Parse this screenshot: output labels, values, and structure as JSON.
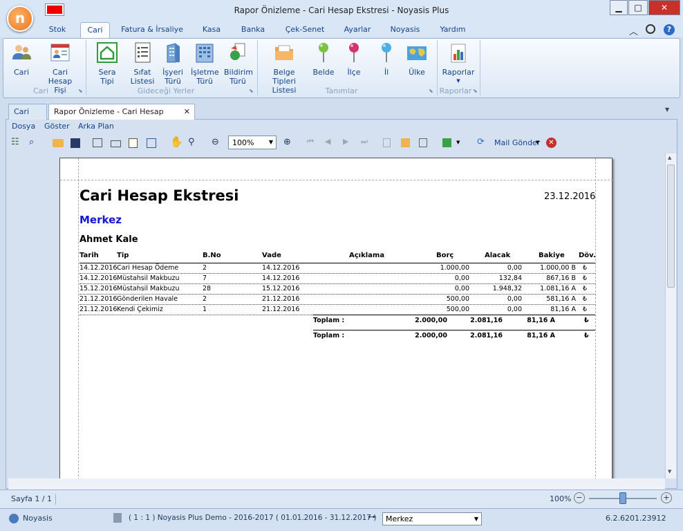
{
  "window": {
    "title": "Rapor Önizleme - Cari Hesap Ekstresi - Noyasis Plus"
  },
  "ribbon_tabs": [
    "Stok",
    "Cari",
    "Fatura & İrsaliye",
    "Kasa",
    "Banka",
    "Çek-Senet",
    "Ayarlar",
    "Noyasis",
    "Yardım"
  ],
  "ribbon": {
    "cari_group": {
      "label": "Cari",
      "buttons": [
        {
          "label": "Cari",
          "icon": "users-icon"
        },
        {
          "label": "Cari Hesap\nFişi",
          "icon": "user-card-icon"
        }
      ]
    },
    "yerler_group": {
      "label": "Gideceği Yerler",
      "buttons": [
        {
          "label": "Sera Tipi",
          "icon": "greenhouse-icon"
        },
        {
          "label": "Sıfat\nListesi",
          "icon": "list-doc-icon"
        },
        {
          "label": "İşyeri\nTürü",
          "icon": "building-icon"
        },
        {
          "label": "İşletme\nTürü",
          "icon": "office-icon"
        },
        {
          "label": "Bildirim\nTürü",
          "icon": "notify-icon"
        }
      ]
    },
    "tanimlar_group": {
      "label": "Tanımlar",
      "buttons": [
        {
          "label": "Belge Tipleri\nListesi",
          "icon": "folder-icon"
        },
        {
          "label": "Belde",
          "icon": "pin-green-icon"
        },
        {
          "label": "İlçe",
          "icon": "pin-red-icon"
        },
        {
          "label": "İl",
          "icon": "pin-blue-icon"
        },
        {
          "label": "Ülke",
          "icon": "map-icon"
        }
      ]
    },
    "raporlar_group": {
      "label": "Raporlar",
      "buttons": [
        {
          "label": "Raporlar",
          "icon": "bar-chart-icon"
        }
      ]
    }
  },
  "doc_tabs": [
    "Cari",
    "Rapor Önizleme - Cari Hesap Ekstresi"
  ],
  "preview_menu": [
    "Dosya",
    "Göster",
    "Arka Plan"
  ],
  "toolbar": {
    "zoom": "100%",
    "mail_label": "Mail Gönder"
  },
  "report": {
    "title": "Cari Hesap Ekstresi",
    "date": "23.12.2016",
    "branch": "Merkez",
    "customer": "Ahmet Kale",
    "columns": [
      "Tarih",
      "Tip",
      "B.No",
      "Vade",
      "Açıklama",
      "Borç",
      "Alacak",
      "Bakiye",
      "Döv."
    ],
    "rows": [
      [
        "14.12.2016",
        "Cari Hesap Ödeme",
        "2",
        "14.12.2016",
        "",
        "1.000,00",
        "0,00",
        "1.000,00 B",
        "₺"
      ],
      [
        "14.12.2016",
        "Müstahsil Makbuzu",
        "7",
        "14.12.2016",
        "",
        "0,00",
        "132,84",
        "867,16 B",
        "₺"
      ],
      [
        "15.12.2016",
        "Müstahsil Makbuzu",
        "28",
        "15.12.2016",
        "",
        "0,00",
        "1.948,32",
        "1.081,16 A",
        "₺"
      ],
      [
        "21.12.2016",
        "Gönderilen Havale",
        "2",
        "21.12.2016",
        "",
        "500,00",
        "0,00",
        "581,16 A",
        "₺"
      ],
      [
        "21.12.2016",
        "Kendi Çekimiz",
        "1",
        "21.12.2016",
        "",
        "500,00",
        "0,00",
        "81,16 A",
        "₺"
      ]
    ],
    "totals": [
      {
        "label": "Toplam  :",
        "borc": "2.000,00",
        "alacak": "2.081,16",
        "bakiye": "81,16 A",
        "dov": "₺"
      },
      {
        "label": "Toplam  :",
        "borc": "2.000,00",
        "alacak": "2.081,16",
        "bakiye": "81,16 A",
        "dov": "₺"
      }
    ]
  },
  "status": {
    "page": "Sayfa 1 / 1",
    "zoom": "100%",
    "zoom_level_pct": 50
  },
  "footer": {
    "user": "Noyasis",
    "company": "( 1 : 1 )  Noyasis Plus Demo - 2016-2017  ( 01.01.2016 - 31.12.2017 )",
    "branch": "Merkez",
    "version": "6.2.6201.23912"
  },
  "colors": {
    "accent": "#15428b",
    "branch_blue": "#1515d6",
    "close_red": "#c4302b"
  }
}
